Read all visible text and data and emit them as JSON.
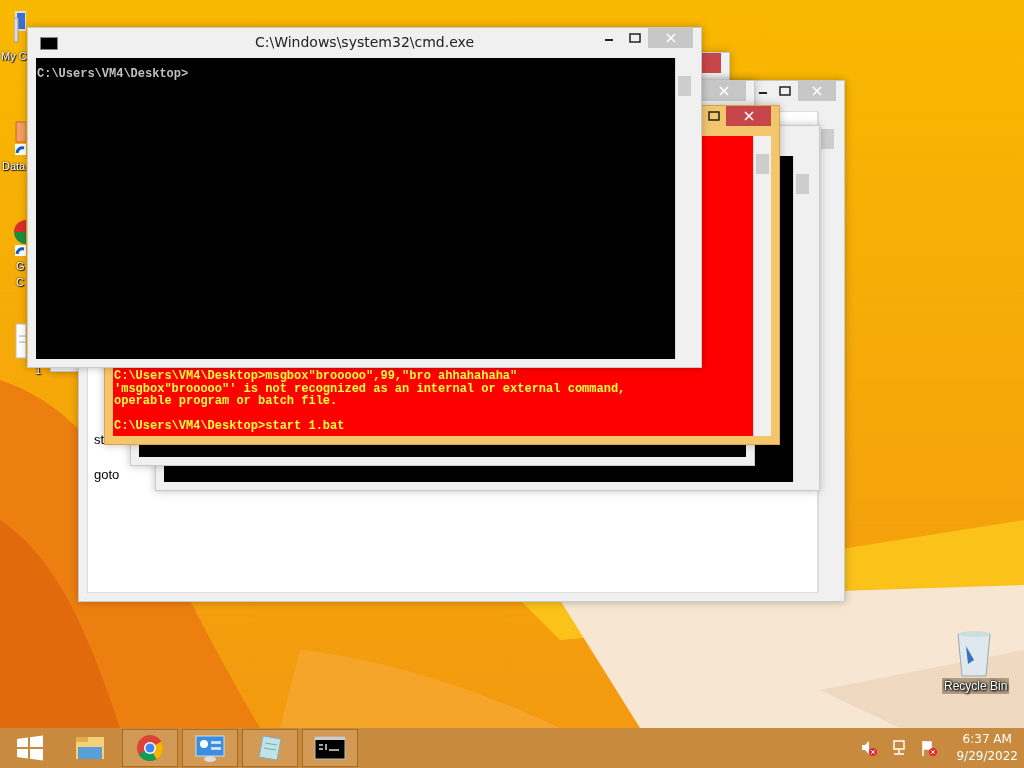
{
  "desktop_icons": [
    {
      "kind": "computer",
      "label_lines": [
        "My C"
      ]
    },
    {
      "kind": "shortcut",
      "label_lines": [
        "Data"
      ]
    },
    {
      "kind": "browser",
      "label_lines": [
        "G",
        "C"
      ]
    },
    {
      "kind": "file",
      "label_lines": [
        "1"
      ]
    },
    {
      "kind": "recycle",
      "label_lines": [
        "Recycle Bin"
      ]
    }
  ],
  "windows": [
    {
      "kind": "console",
      "focused": true
    },
    {
      "kind": "editor",
      "focused": false,
      "lines": [
        "st",
        "goto"
      ]
    },
    {
      "kind": "console",
      "color": "#000000"
    },
    {
      "kind": "console",
      "focused": false,
      "color": "#000000"
    },
    {
      "kind": "console",
      "focused": true,
      "color": "#ff0000",
      "paragraphs": [
        [
          "C:\\Users\\VM4\\Desktop>msgbox\"brooooo\",99,\"bro ahhahahaha\"",
          "'msgbox\"brooooo\"' is not recognized as an internal or external command,",
          "operable program or batch file."
        ],
        [
          "C:\\Users\\VM4\\Desktop>start 1.bat"
        ]
      ]
    },
    {
      "kind": "console",
      "focused": false,
      "title": "C:\\Windows\\system32\\cmd.exe",
      "color": "#000000",
      "paragraphs": [
        [
          "C:\\Users\\VM4\\Desktop>"
        ]
      ]
    }
  ],
  "taskbar": {
    "items": [
      {
        "kind": "start",
        "running": false
      },
      {
        "kind": "explorer",
        "running": false
      },
      {
        "kind": "chrome",
        "running": true
      },
      {
        "kind": "control-panel",
        "running": true
      },
      {
        "kind": "notepad",
        "running": true
      },
      {
        "kind": "console",
        "running": true
      }
    ],
    "tray": {
      "time": "6:37 AM",
      "date": "9/29/2022"
    }
  }
}
